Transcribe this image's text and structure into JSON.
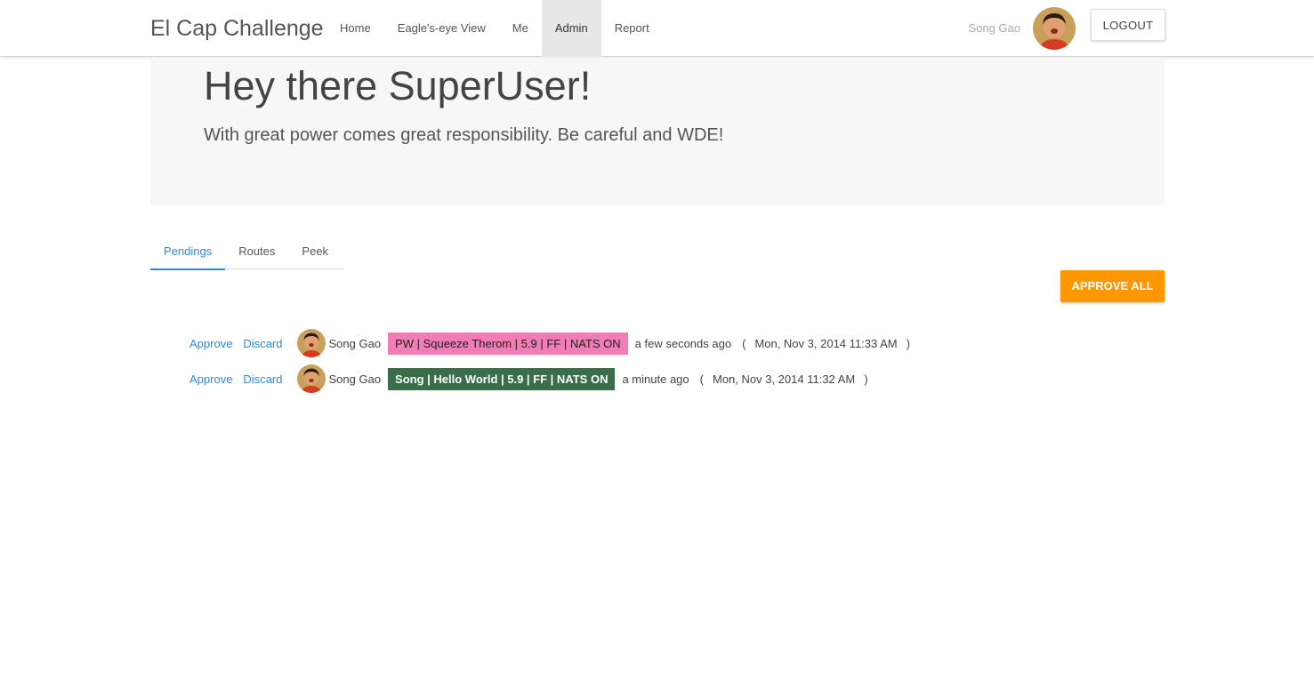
{
  "app": {
    "title": "El Cap Challenge"
  },
  "nav": {
    "items": [
      {
        "label": "Home"
      },
      {
        "label": "Eagle's-eye View"
      },
      {
        "label": "Me"
      },
      {
        "label": "Admin",
        "active": true
      },
      {
        "label": "Report"
      }
    ]
  },
  "user": {
    "name": "Song Gao",
    "logout_label": "LOGOUT"
  },
  "hero": {
    "heading": "Hey there SuperUser!",
    "subheading": "With great power comes great responsibility. Be careful and WDE!"
  },
  "tabs": [
    {
      "label": "Pendings",
      "active": true
    },
    {
      "label": "Routes"
    },
    {
      "label": "Peek"
    }
  ],
  "actions": {
    "approve_all_label": "APPROVE ALL"
  },
  "pendings": [
    {
      "approve_label": "Approve",
      "discard_label": "Discard",
      "user": "Song Gao",
      "route": "PW | Squeeze Therom | 5.9 | FF | NATS ON",
      "route_color": "#f27cb6",
      "relative_time": "a few seconds ago",
      "open_paren": "(",
      "timestamp": "Mon, Nov 3, 2014 11:33 AM",
      "close_paren": ")"
    },
    {
      "approve_label": "Approve",
      "discard_label": "Discard",
      "user": "Song Gao",
      "route": "Song | Hello World | 5.9 | FF | NATS ON",
      "route_color": "#3a6e4b",
      "relative_time": "a minute ago",
      "open_paren": "(",
      "timestamp": "Mon, Nov 3, 2014 11:32 AM",
      "close_paren": ")"
    }
  ],
  "colors": {
    "accent": "#2c8ad8",
    "approve_all": "#ff9800",
    "nav_active_bg": "#e7e7e7"
  }
}
